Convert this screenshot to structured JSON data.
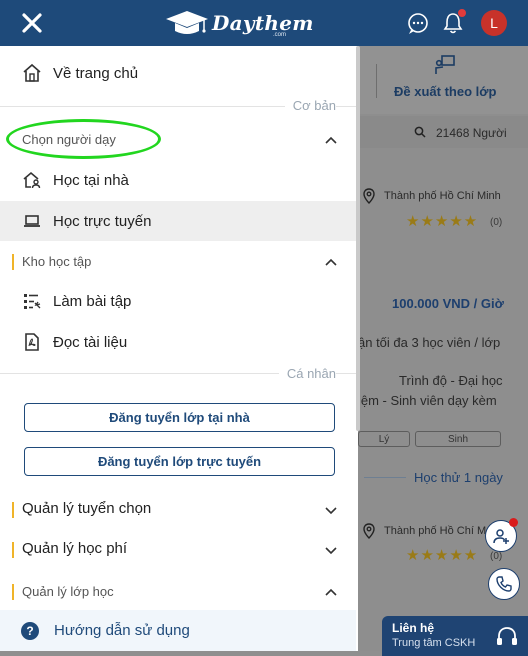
{
  "header": {
    "brand": "Daythem",
    "brand_sub": ".com",
    "avatar_letter": "L"
  },
  "drawer": {
    "home": "Về trang chủ",
    "section_basic": "Cơ bản",
    "group_choose_tutor": "Chọn người dạy",
    "item_home_tutor": "Học tại nhà",
    "item_online": "Học trực tuyến",
    "group_library": "Kho học tập",
    "item_exercises": "Làm bài tập",
    "item_documents": "Đọc tài liệu",
    "section_personal": "Cá nhân",
    "btn_post_home": "Đăng tuyển lớp tại nhà",
    "btn_post_online": "Đăng tuyển lớp trực tuyến",
    "group_manage_select": "Quản lý tuyển chọn",
    "group_manage_fee": "Quản lý học phí",
    "group_manage_class": "Quản lý lớp học",
    "help": "Hướng dẫn sử dụng"
  },
  "background": {
    "tab_suggest": "Đề xuất theo lớp",
    "count": "21468 Người",
    "city1": "Thành phố Hồ Chí Minh",
    "rating1": "(0)",
    "price": "100.000 VND / Giờ",
    "capacity": "ận tối đa 3 học viên / lớp",
    "level": "Trình độ - Đại học",
    "experience": "iệm - Sinh viên dạy kèm",
    "chip1": "Lý",
    "chip2": "Sinh",
    "trial": "Học thử 1 ngày",
    "city2": "Thành phố Hồ Chí M",
    "rating2": "(0)",
    "stars": "★★★★★",
    "contact_title": "Liên hệ",
    "contact_sub": "Trung tâm CSKH"
  },
  "colors": {
    "header_bg": "#1e4a7a",
    "accent": "#1f4a7a",
    "group_bar": "#f0b429",
    "annotation": "#22d61f",
    "avatar": "#c8322a"
  }
}
